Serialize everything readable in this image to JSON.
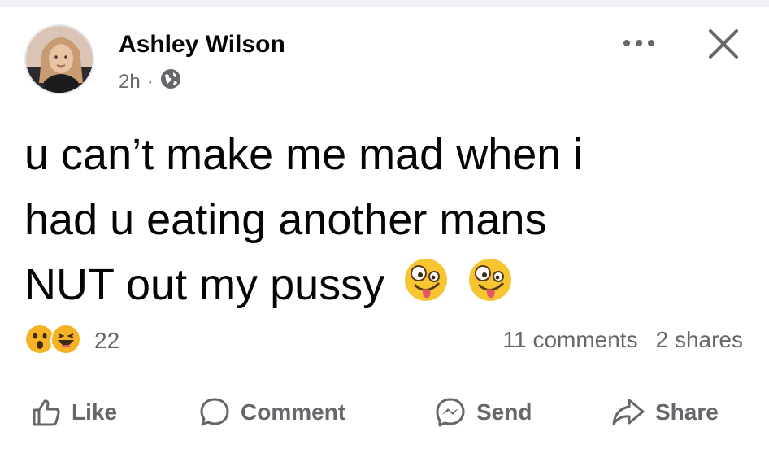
{
  "post": {
    "author": "Ashley Wilson",
    "time": "2h",
    "separator": "·",
    "audience_icon": "globe-icon",
    "text_lines": [
      "u can’t make me mad when i",
      "had u eating another mans",
      "NUT out my pussy"
    ],
    "trailing_emojis": [
      "zany-face-emoji",
      "zany-face-emoji"
    ]
  },
  "header_actions": {
    "more_icon": "more-options-icon",
    "close_icon": "close-icon"
  },
  "reactions": {
    "icons": [
      "wow-reaction-icon",
      "haha-reaction-icon"
    ],
    "count": "22"
  },
  "stats": {
    "comments": "11 comments",
    "shares": "2 shares"
  },
  "actions": {
    "like": "Like",
    "comment": "Comment",
    "send": "Send",
    "share": "Share"
  },
  "colors": {
    "text": "#050505",
    "secondary": "#65676b",
    "reaction_yellow": "#f7b125"
  }
}
